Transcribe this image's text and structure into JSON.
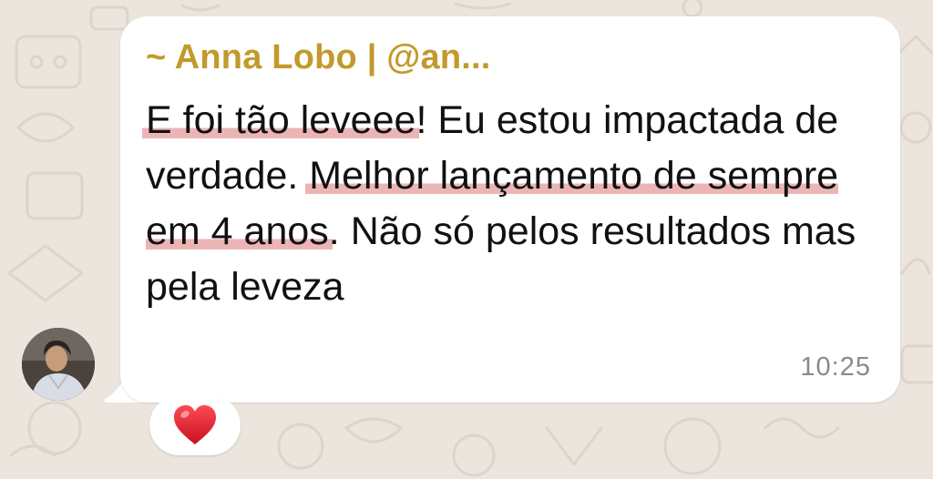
{
  "message": {
    "sender": "~ Anna Lobo | @an...",
    "segments": [
      {
        "text": "E foi tão leveee",
        "highlight": true
      },
      {
        "text": "! Eu estou impactada de verdade. ",
        "highlight": false
      },
      {
        "text": "Melhor lançamento de sempre em 4 anos",
        "highlight": true
      },
      {
        "text": ". Não só pelos resultados mas pela leveza",
        "highlight": false
      }
    ],
    "time": "10:25"
  },
  "reaction": {
    "icon": "red-heart-icon"
  },
  "avatar": {
    "icon": "profile-photo"
  },
  "colors": {
    "wallpaper": "#ece5dd",
    "bubble": "#ffffff",
    "sender": "#c29a2c",
    "highlight": "#dc7878",
    "time": "#8a8a8a",
    "heart": "#e0192b"
  }
}
